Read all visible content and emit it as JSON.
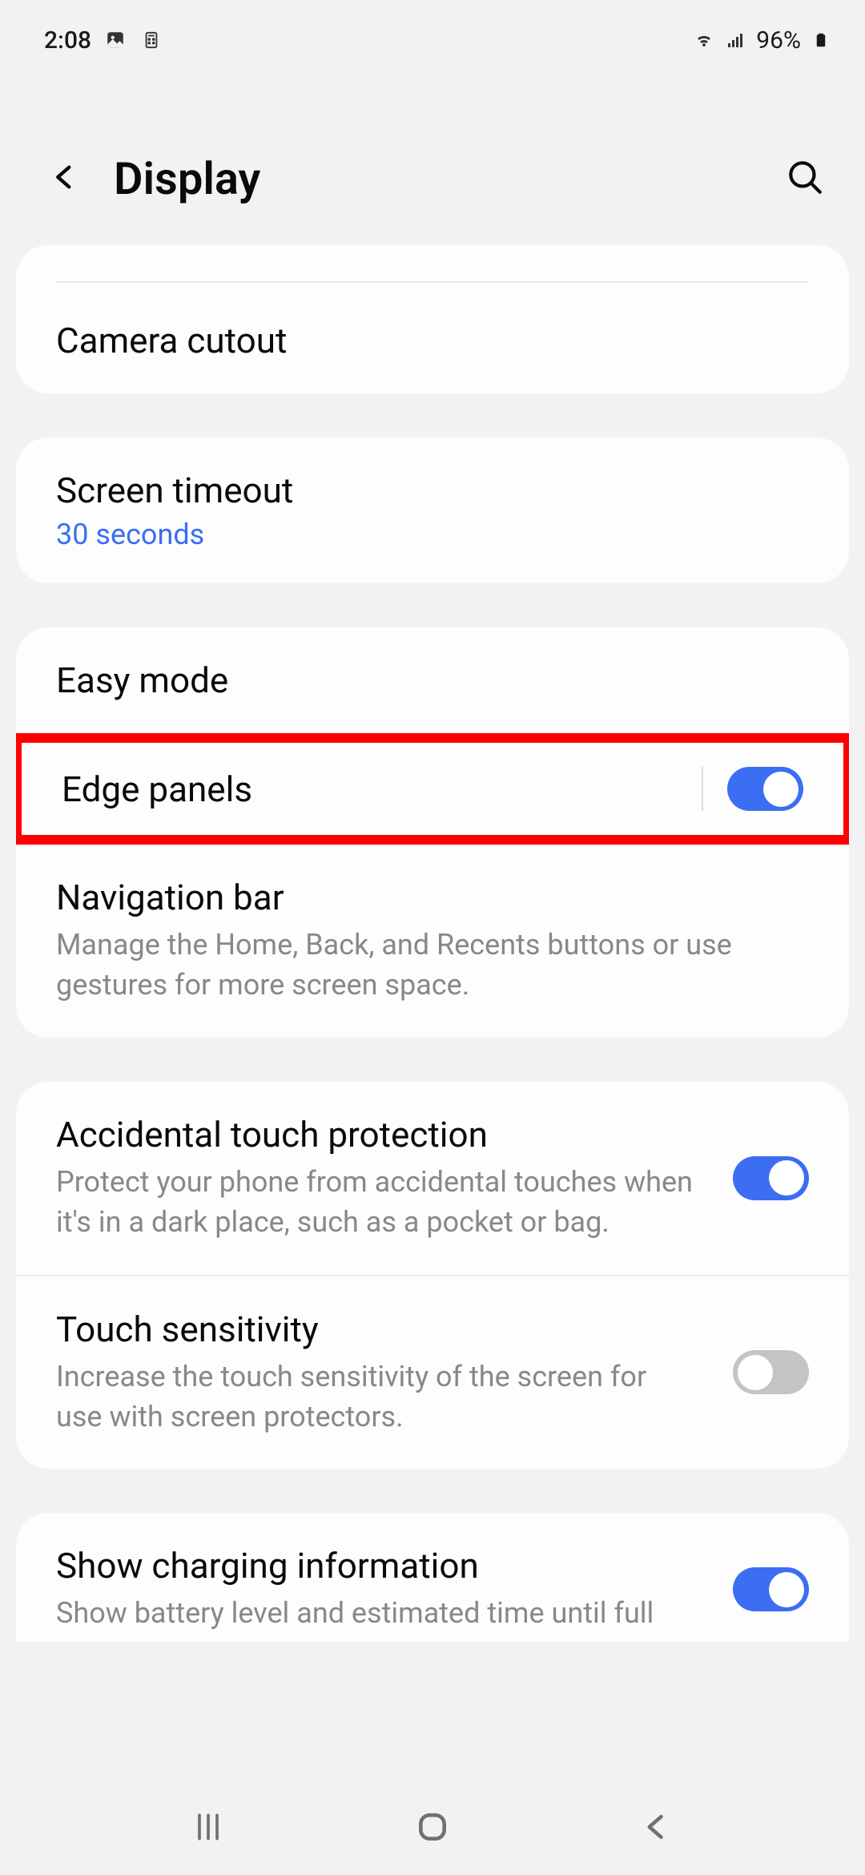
{
  "status_bar": {
    "time": "2:08",
    "battery": "96%"
  },
  "header": {
    "title": "Display"
  },
  "groups": [
    {
      "items": [
        {
          "title": "Camera cutout"
        }
      ]
    },
    {
      "items": [
        {
          "title": "Screen timeout",
          "value": "30 seconds"
        }
      ]
    },
    {
      "items": [
        {
          "title": "Easy mode"
        },
        {
          "title": "Edge panels",
          "toggle": true,
          "on": true,
          "highlighted": true
        },
        {
          "title": "Navigation bar",
          "desc": "Manage the Home, Back, and Recents buttons or use gestures for more screen space."
        }
      ]
    },
    {
      "items": [
        {
          "title": "Accidental touch protection",
          "desc": "Protect your phone from accidental touches when it's in a dark place, such as a pocket or bag.",
          "toggle": true,
          "on": true
        },
        {
          "title": "Touch sensitivity",
          "desc": "Increase the touch sensitivity of the screen for use with screen protectors.",
          "toggle": true,
          "on": false
        }
      ]
    },
    {
      "items": [
        {
          "title": "Show charging information",
          "desc": "Show battery level and estimated time until full",
          "toggle": true,
          "on": true
        }
      ]
    }
  ]
}
